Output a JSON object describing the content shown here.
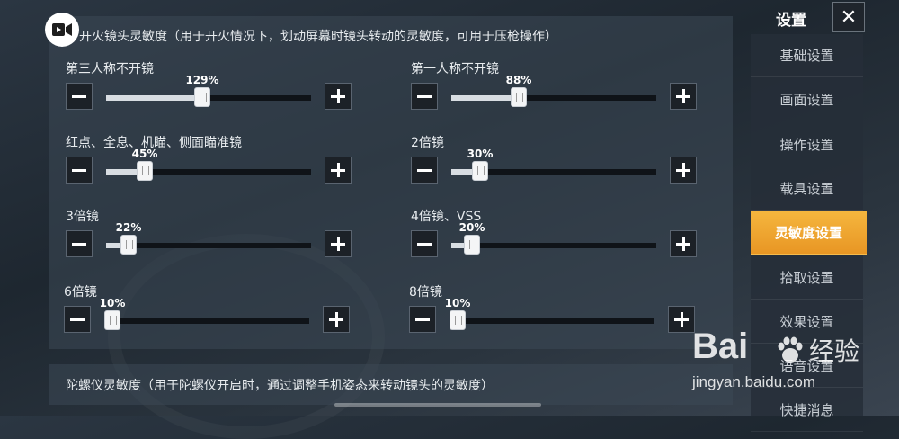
{
  "fire_section": {
    "title": "开火镜头灵敏度（用于开火情况下，划动屏幕时镜头转动的灵敏度，可用于压枪操作）",
    "items": [
      {
        "label": "第三人称不开镜",
        "value_text": "129%",
        "fraction": 0.43
      },
      {
        "label": "第一人称不开镜",
        "value_text": "88%",
        "fraction": 0.29
      },
      {
        "label": "红点、全息、机瞄、侧面瞄准镜",
        "value_text": "45%",
        "fraction": 0.15
      },
      {
        "label": "2倍镜",
        "value_text": "30%",
        "fraction": 0.1
      },
      {
        "label": "3倍镜",
        "value_text": "22%",
        "fraction": 0.07
      },
      {
        "label": "4倍镜、VSS",
        "value_text": "20%",
        "fraction": 0.06
      },
      {
        "label": "6倍镜",
        "value_text": "10%",
        "fraction": 0.0
      },
      {
        "label": "8倍镜",
        "value_text": "10%",
        "fraction": 0.0
      }
    ]
  },
  "gyro_section": {
    "title": "陀螺仪灵敏度（用于陀螺仪开启时，通过调整手机姿态来转动镜头的灵敏度）"
  },
  "sidebar": {
    "title": "设置",
    "items": [
      {
        "label": "基础设置",
        "active": false
      },
      {
        "label": "画面设置",
        "active": false
      },
      {
        "label": "操作设置",
        "active": false
      },
      {
        "label": "载具设置",
        "active": false
      },
      {
        "label": "灵敏度设置",
        "active": true
      },
      {
        "label": "拾取设置",
        "active": false
      },
      {
        "label": "效果设置",
        "active": false
      },
      {
        "label": "语音设置",
        "active": false
      },
      {
        "label": "快捷消息",
        "active": false
      }
    ]
  },
  "icons": {
    "record": "video-camera-icon",
    "close": "close-icon",
    "minus": "minus-icon",
    "plus": "plus-icon"
  },
  "watermark": {
    "brand": "Bai",
    "brand_suffix": "经验",
    "url": "jingyan.baidu.com"
  },
  "colors": {
    "accent": "#f0a532",
    "panel": "#3c4856"
  }
}
